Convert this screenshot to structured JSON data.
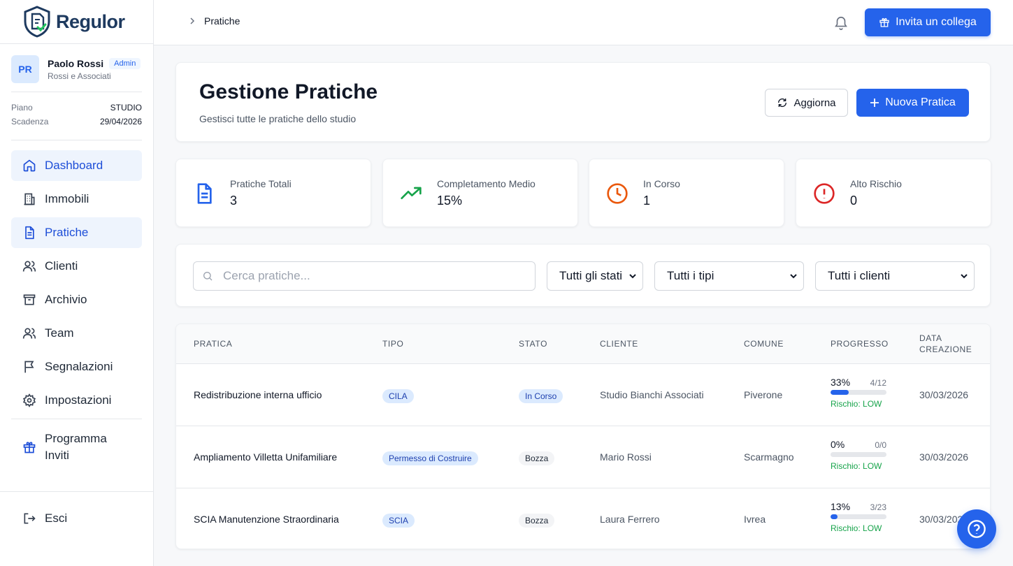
{
  "app": {
    "name": "Regulor"
  },
  "user": {
    "initials": "PR",
    "name": "Paolo Rossi",
    "role": "Admin",
    "company": "Rossi e Associati"
  },
  "plan": {
    "plan_label": "Piano",
    "plan_value": "STUDIO",
    "expiry_label": "Scadenza",
    "expiry_value": "29/04/2026"
  },
  "nav": [
    {
      "label": "Dashboard",
      "icon": "home-icon"
    },
    {
      "label": "Immobili",
      "icon": "building-icon"
    },
    {
      "label": "Pratiche",
      "icon": "file-icon"
    },
    {
      "label": "Clienti",
      "icon": "users-icon"
    },
    {
      "label": "Archivio",
      "icon": "archive-icon"
    },
    {
      "label": "Team",
      "icon": "team-icon"
    },
    {
      "label": "Segnalazioni",
      "icon": "flag-icon"
    },
    {
      "label": "Impostazioni",
      "icon": "gear-icon"
    }
  ],
  "invite_program": {
    "line1": "Programma",
    "line2": "Inviti"
  },
  "logout": {
    "label": "Esci"
  },
  "breadcrumb": {
    "current": "Pratiche"
  },
  "topbar": {
    "invite_label": "Invita un collega"
  },
  "header": {
    "title": "Gestione Pratiche",
    "subtitle": "Gestisci tutte le pratiche dello studio",
    "refresh_label": "Aggiorna",
    "new_label": "Nuova Pratica"
  },
  "stats": [
    {
      "label": "Pratiche Totali",
      "value": "3",
      "icon": "document-icon",
      "color": "#2563eb"
    },
    {
      "label": "Completamento Medio",
      "value": "15%",
      "icon": "trending-up-icon",
      "color": "#16a34a"
    },
    {
      "label": "In Corso",
      "value": "1",
      "icon": "clock-icon",
      "color": "#ea580c"
    },
    {
      "label": "Alto Rischio",
      "value": "0",
      "icon": "alert-circle-icon",
      "color": "#dc2626"
    }
  ],
  "filters": {
    "search_placeholder": "Cerca pratiche...",
    "status": "Tutti gli stati",
    "type": "Tutti i tipi",
    "client": "Tutti i clienti"
  },
  "table": {
    "headers": {
      "pratica": "PRATICA",
      "tipo": "TIPO",
      "stato": "STATO",
      "cliente": "CLIENTE",
      "comune": "COMUNE",
      "progresso": "PROGRESSO",
      "data1": "DATA",
      "data2": "CREAZIONE"
    },
    "rows": [
      {
        "name": "Redistribuzione interna ufficio",
        "type": "CILA",
        "status": "In Corso",
        "client": "Studio Bianchi Associati",
        "city": "Piverone",
        "pct": "33%",
        "frac": "4/12",
        "progress": 0.33,
        "risk": "Rischio: LOW",
        "date": "30/03/2026"
      },
      {
        "name": "Ampliamento Villetta Unifamiliare",
        "type": "Permesso di Costruire",
        "status": "Bozza",
        "client": "Mario Rossi",
        "city": "Scarmagno",
        "pct": "0%",
        "frac": "0/0",
        "progress": 0,
        "risk": "Rischio: LOW",
        "date": "30/03/2026"
      },
      {
        "name": "SCIA Manutenzione Straordinaria",
        "type": "SCIA",
        "status": "Bozza",
        "client": "Laura Ferrero",
        "city": "Ivrea",
        "pct": "13%",
        "frac": "3/23",
        "progress": 0.13,
        "risk": "Rischio: LOW",
        "date": "30/03/2026"
      }
    ]
  },
  "colors": {
    "primary": "#2563eb",
    "success": "#16a34a"
  }
}
